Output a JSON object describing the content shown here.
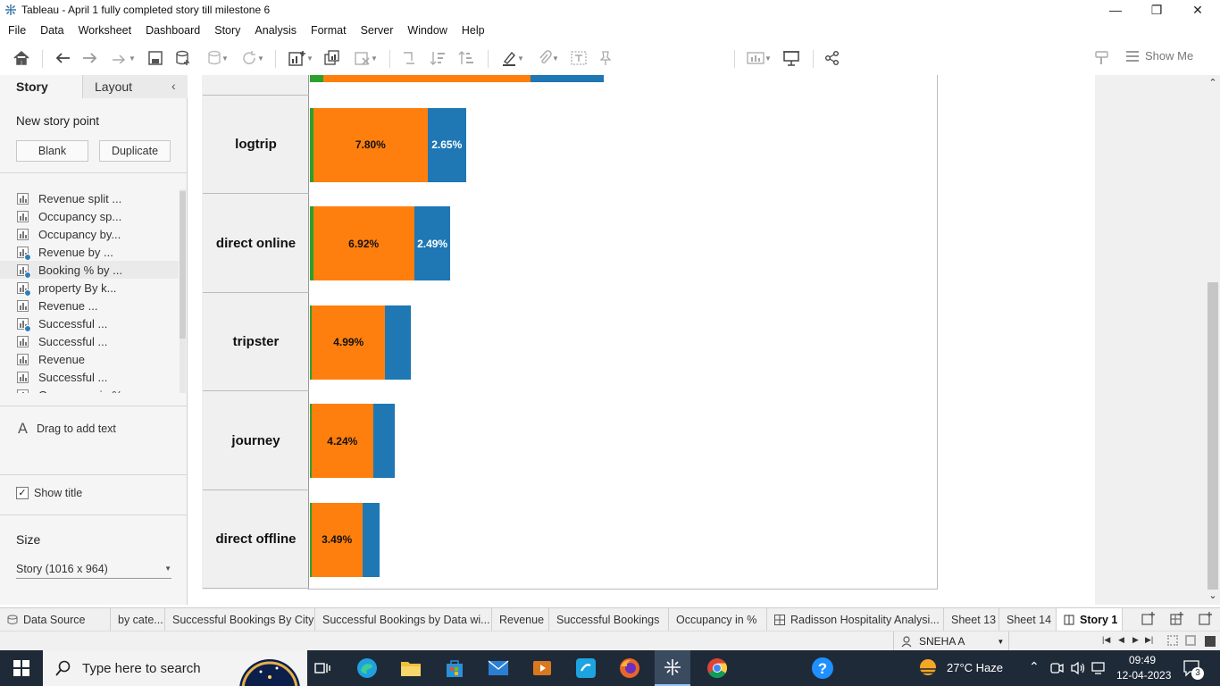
{
  "window": {
    "title": "Tableau - April 1 fully completed story till milestone 6",
    "min": "—",
    "restore": "❐",
    "close": "✕"
  },
  "menu": [
    "File",
    "Data",
    "Worksheet",
    "Dashboard",
    "Story",
    "Analysis",
    "Format",
    "Server",
    "Window",
    "Help"
  ],
  "toolbar": {
    "show_me": "Show Me"
  },
  "left_pane": {
    "tab_story": "Story",
    "tab_layout": "Layout",
    "collapse": "‹",
    "new_story_point": "New story point",
    "blank_btn": "Blank",
    "duplicate_btn": "Duplicate",
    "sheets": [
      {
        "label": "Revenue split ...",
        "dashboard": false
      },
      {
        "label": "Occupancy sp...",
        "dashboard": false
      },
      {
        "label": "Occupancy by...",
        "dashboard": false
      },
      {
        "label": "Revenue by ...",
        "dashboard": true
      },
      {
        "label": "Booking % by ...",
        "dashboard": true
      },
      {
        "label": "property By k...",
        "dashboard": true
      },
      {
        "label": "Revenue ...",
        "dashboard": false
      },
      {
        "label": "Successful ...",
        "dashboard": true
      },
      {
        "label": "Successful ...",
        "dashboard": false
      },
      {
        "label": "Revenue",
        "dashboard": false
      },
      {
        "label": "Successful ...",
        "dashboard": false
      },
      {
        "label": "Occupancy in %",
        "dashboard": false
      }
    ],
    "drag_text": "Drag to add text",
    "show_title": "Show title",
    "size_label": "Size",
    "size_value": "Story (1016 x 964)"
  },
  "chart_data": {
    "type": "bar",
    "orientation": "horizontal-stacked",
    "categories": [
      "logtrip",
      "direct online",
      "tripster",
      "journey",
      "direct offline"
    ],
    "series": [
      {
        "color": "#2ca02c",
        "values": [
          0.25,
          0.22,
          0.15,
          0.1,
          0.1
        ]
      },
      {
        "color": "#ff7f0e",
        "values": [
          7.8,
          6.92,
          4.99,
          4.24,
          3.49
        ],
        "labels": [
          "7.80%",
          "6.92%",
          "4.99%",
          "4.24%",
          "3.49%"
        ]
      },
      {
        "color": "#1f77b4",
        "values": [
          2.65,
          2.49,
          1.75,
          1.5,
          1.2
        ],
        "labels": [
          "2.65%",
          "2.49%",
          "",
          "",
          ""
        ]
      }
    ],
    "top_partial_bar": {
      "values": [
        0.9,
        14.2,
        5.0
      ]
    }
  },
  "bottom_tabs": [
    {
      "label": "Data Source",
      "icon": "datasource-icon"
    },
    {
      "label": "by cate..."
    },
    {
      "label": "Successful Bookings By City"
    },
    {
      "label": "Successful Bookings by Data wi..."
    },
    {
      "label": "Revenue"
    },
    {
      "label": "Successful Bookings"
    },
    {
      "label": "Occupancy in %"
    },
    {
      "label": "Radisson Hospitality Analysi...",
      "icon": "dashboard-icon"
    },
    {
      "label": "Sheet 13"
    },
    {
      "label": "Sheet 14"
    },
    {
      "label": "Story 1",
      "icon": "story-icon",
      "active": true
    }
  ],
  "status": {
    "user": "SNEHA A"
  },
  "taskbar": {
    "search_placeholder": "Type here to search",
    "weather": "27°C  Haze",
    "time": "09:49",
    "date": "12-04-2023",
    "notifications": "3"
  }
}
